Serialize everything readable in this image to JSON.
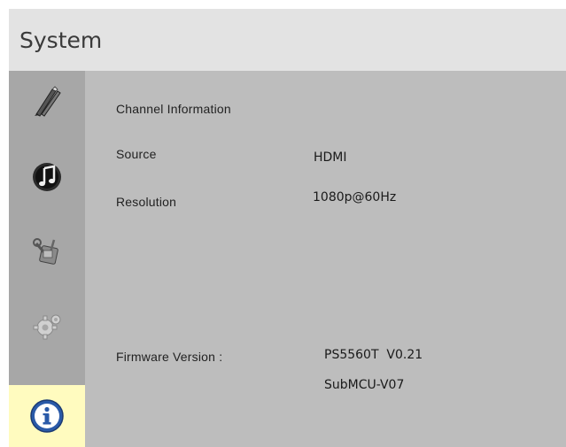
{
  "header": {
    "title": "System"
  },
  "sidebar": {
    "items": [
      {
        "name": "picture",
        "icon": "pencil-brush-icon"
      },
      {
        "name": "sound",
        "icon": "music-note-icon"
      },
      {
        "name": "setup",
        "icon": "tools-icon"
      },
      {
        "name": "advanced",
        "icon": "gear-icon"
      },
      {
        "name": "information",
        "icon": "info-icon",
        "active": true
      }
    ],
    "active_color": "#fffbbf"
  },
  "info": {
    "section_title": "Channel Information",
    "source_label": "Source",
    "source_value": "HDMI",
    "resolution_label": "Resolution",
    "resolution_value": "1080p@60Hz",
    "firmware_label": "Firmware Version :",
    "firmware_value": "PS5560T  V0.21",
    "submcu_value": "SubMCU-V07"
  }
}
